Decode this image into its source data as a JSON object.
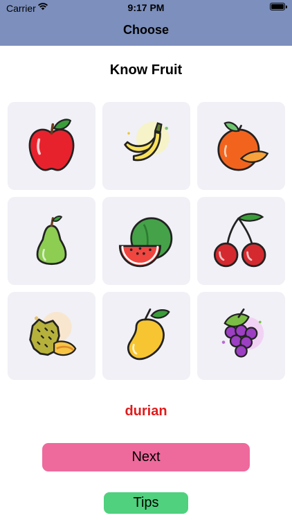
{
  "status_bar": {
    "carrier": "Carrier",
    "time": "9:17 PM"
  },
  "nav": {
    "title": "Choose"
  },
  "page": {
    "title": "Know Fruit"
  },
  "fruits": [
    {
      "icon": "apple-icon"
    },
    {
      "icon": "banana-icon"
    },
    {
      "icon": "orange-icon"
    },
    {
      "icon": "pear-icon"
    },
    {
      "icon": "watermelon-icon"
    },
    {
      "icon": "cherry-icon"
    },
    {
      "icon": "durian-icon"
    },
    {
      "icon": "mango-icon"
    },
    {
      "icon": "grape-icon"
    }
  ],
  "answer": {
    "text": "durian",
    "color": "#e01b1b"
  },
  "buttons": {
    "next": "Next",
    "tips": "Tips"
  },
  "colors": {
    "header": "#7c8fbd",
    "tile": "#f0f0f6",
    "next": "#ee6a9c",
    "tips": "#4fd17e"
  }
}
